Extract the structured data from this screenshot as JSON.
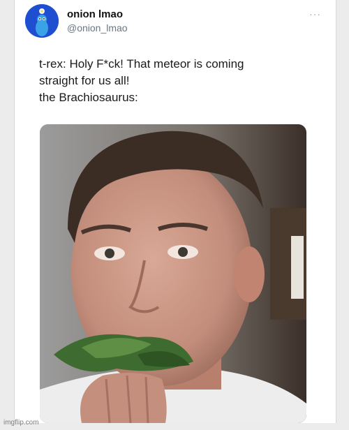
{
  "tweet": {
    "display_name": "onion lmao",
    "handle": "@onion_lmao",
    "more_label": "···",
    "text_lines": [
      "t-rex: Holy F*ck! That meteor is coming",
      "straight for us all!",
      "the Brachiosaurus:"
    ]
  },
  "media": {
    "description_icon": "photo-man-eating-leaves"
  },
  "watermark": "imgflip.com",
  "colors": {
    "avatar_bg": "#1d4fd0",
    "text": "#1a1a1a",
    "handle": "#6b7680"
  }
}
